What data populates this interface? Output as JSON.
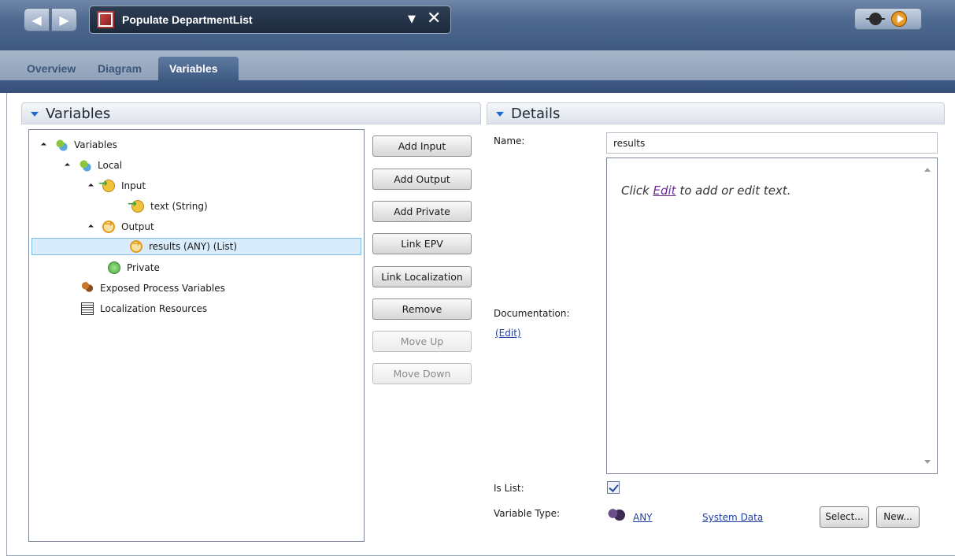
{
  "window": {
    "title": "Populate DepartmentList"
  },
  "tabs": [
    {
      "label": "Overview"
    },
    {
      "label": "Diagram"
    },
    {
      "label": "Variables"
    }
  ],
  "variables_panel": {
    "title": "Variables",
    "tree": {
      "root": "Variables",
      "local": "Local",
      "input": "Input",
      "input_item": "text (String)",
      "output": "Output",
      "output_item": "results (ANY) (List)",
      "private": "Private",
      "epv": "Exposed Process Variables",
      "localization": "Localization Resources"
    },
    "buttons": {
      "add_input": "Add Input",
      "add_output": "Add Output",
      "add_private": "Add Private",
      "link_epv": "Link EPV",
      "link_localization": "Link Localization",
      "remove": "Remove",
      "move_up": "Move Up",
      "move_down": "Move Down"
    }
  },
  "details_panel": {
    "title": "Details",
    "name_label": "Name:",
    "name_value": "results",
    "doc_prefix": "Click ",
    "doc_link": "Edit",
    "doc_suffix": " to add or edit text.",
    "documentation_label": "Documentation:",
    "documentation_edit": "(Edit)",
    "is_list_label": "Is List:",
    "is_list_checked": true,
    "variable_type_label": "Variable Type:",
    "variable_type_value": "ANY",
    "system_data": "System Data",
    "select_button": "Select...",
    "new_button": "New..."
  }
}
